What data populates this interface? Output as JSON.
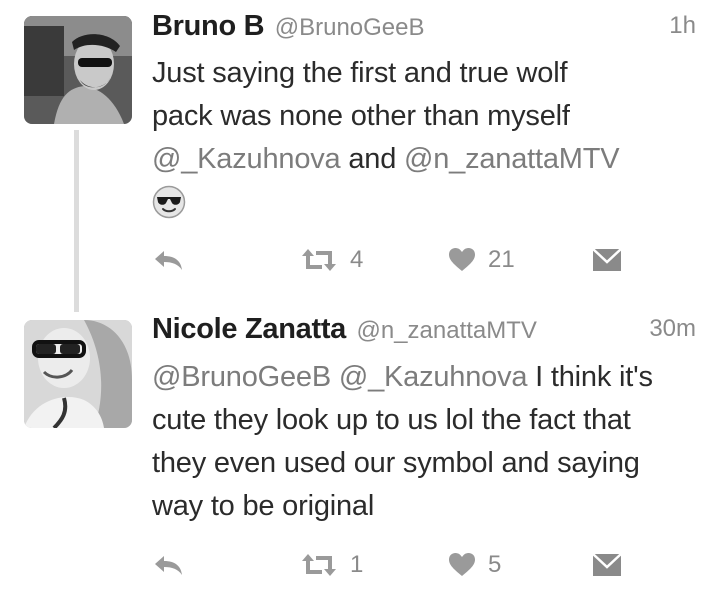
{
  "tweets": [
    {
      "name": "Bruno B",
      "handle": "@BrunoGeeB",
      "time": "1h",
      "text_lines": [
        "Just saying the first and true wolf",
        "pack was none other than myself"
      ],
      "mention1": "@_Kazuhnova",
      "connector": " and ",
      "mention2": "@n_zanattaMTV",
      "emoji": "sunglasses-emoji",
      "retweets": "4",
      "likes": "21"
    },
    {
      "name": "Nicole Zanatta",
      "handle": "@n_zanattaMTV",
      "time": "30m",
      "mention1": "@BrunoGeeB",
      "mention2": "@_Kazuhnova",
      "text_first": " I think it's",
      "text_lines": [
        "cute they look up to us lol the fact that",
        "they even used our symbol and saying",
        "way to be original"
      ],
      "retweets": "1",
      "likes": "5"
    }
  ],
  "icons": {
    "reply": "reply-icon",
    "retweet": "retweet-icon",
    "like": "heart-icon",
    "dm": "direct-message-icon"
  },
  "colors": {
    "text": "#2b2b2b",
    "muted": "#8a8a8a",
    "mention": "#7c7c7c",
    "thread_line": "#dcdcdc"
  }
}
